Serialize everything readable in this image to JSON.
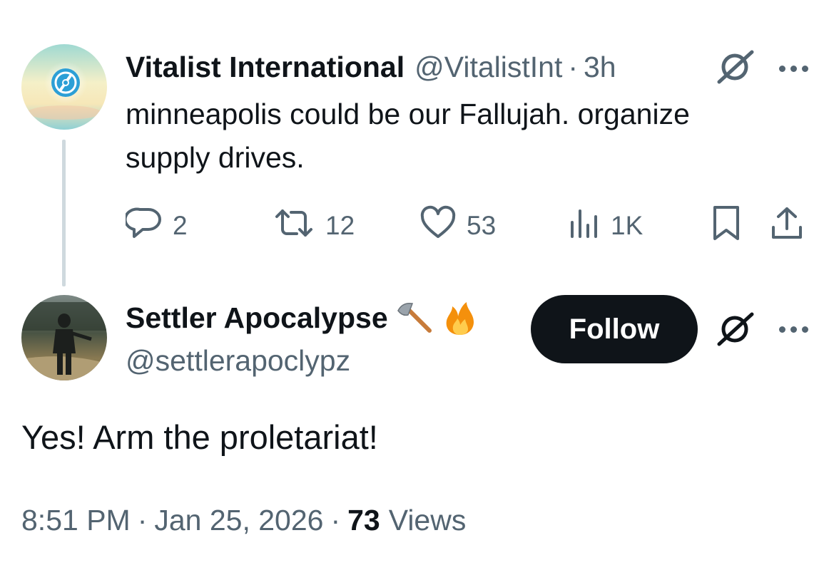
{
  "parent_tweet": {
    "author_name": "Vitalist International",
    "handle": "@VitalistInt",
    "separator": "·",
    "time": "3h",
    "grok_icon": "grok-icon",
    "more_icon": "more-dots-icon",
    "text": "minneapolis could be our Fallujah. organize supply drives.",
    "actions": {
      "reply_count": "2",
      "retweet_count": "12",
      "like_count": "53",
      "views_count": "1K"
    },
    "avatar_icon": "vitalist-logo-avatar"
  },
  "reply_tweet": {
    "author_name": "Settler Apocalypse",
    "emojis": [
      "axe-emoji",
      "fire-emoji"
    ],
    "handle": "@settlerapoclypz",
    "follow_label": "Follow",
    "text": "Yes! Arm the proletariat!",
    "timestamp": "8:51 PM",
    "separator": "·",
    "date": "Jan 25, 2026",
    "views_count": "73",
    "views_label": "Views",
    "avatar_icon": "person-photo-avatar"
  },
  "colors": {
    "text_primary": "#0f1419",
    "text_secondary": "#536471",
    "follow_button_bg": "#0f1419",
    "thread_line": "#cfd9de"
  }
}
